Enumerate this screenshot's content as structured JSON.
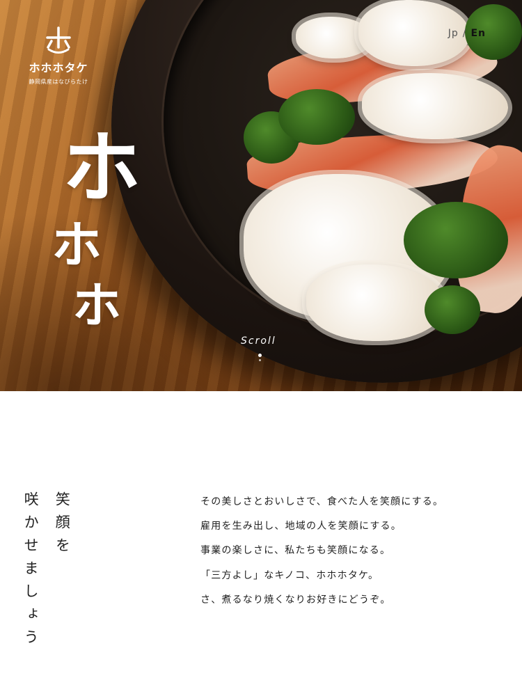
{
  "logo": {
    "mark": "ホ",
    "name": "ホホホタケ",
    "subtitle": "静岡県産はなびらたけ"
  },
  "lang_switch": {
    "jp": "Jp",
    "separator": "/",
    "en": "En"
  },
  "hero": {
    "glyphs": [
      "ホ",
      "ホ",
      "ホ"
    ],
    "scroll_label": "Scroll"
  },
  "tagline": {
    "col1": "笑顔を",
    "col2": "咲かせましょう"
  },
  "body": {
    "lines": [
      "その美しさとおいしさで、食べた人を笑顔にする。",
      "雇用を生み出し、地域の人を笑顔にする。",
      "事業の楽しさに、私たちも笑顔になる。",
      "「三方よし」なキノコ、ホホホタケ。",
      "さ、煮るなり焼くなりお好きにどうぞ。"
    ]
  },
  "colors": {
    "accent_white": "#ffffff",
    "text_dark": "#222222",
    "wood": "#a35e22"
  }
}
